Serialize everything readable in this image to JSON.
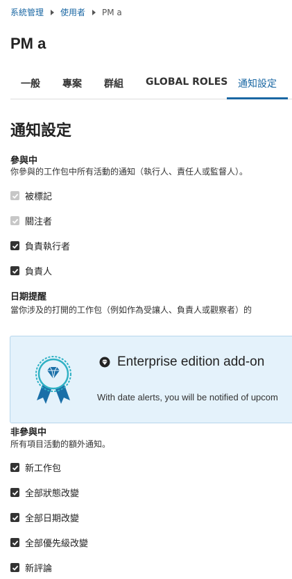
{
  "breadcrumb": {
    "items": [
      "系統管理",
      "使用者"
    ],
    "current": "PM a"
  },
  "page_title": "PM a",
  "tabs": [
    {
      "label": "一般"
    },
    {
      "label": "專案"
    },
    {
      "label": "群組"
    },
    {
      "label": "GLOBAL ROLES"
    },
    {
      "label": "通知設定",
      "active": true
    }
  ],
  "section_title": "通知設定",
  "participating": {
    "title": "參與中",
    "description": "你參與的工作包中所有活動的通知（執行人、責任人或監督人）。",
    "options": [
      {
        "label": "被標記",
        "checked": true,
        "disabled": true
      },
      {
        "label": "關注者",
        "checked": true,
        "disabled": true
      },
      {
        "label": "負責執行者",
        "checked": true,
        "disabled": false
      },
      {
        "label": "負責人",
        "checked": true,
        "disabled": false
      }
    ]
  },
  "date_alerts": {
    "title": "日期提醒",
    "description": "當你涉及的打開的工作包（例如作為受讓人、負責人或觀察者）的",
    "enterprise": {
      "title": "Enterprise edition add-on",
      "text": "With date alerts, you will be notified of upcom"
    }
  },
  "non_participating": {
    "title": "非參與中",
    "description": "所有項目活動的額外通知。",
    "options": [
      {
        "label": "新工作包",
        "checked": true
      },
      {
        "label": "全部狀態改變",
        "checked": true
      },
      {
        "label": "全部日期改變",
        "checked": true
      },
      {
        "label": "全部優先級改變",
        "checked": true
      },
      {
        "label": "新評論",
        "checked": true
      }
    ]
  },
  "colors": {
    "accent": "#1a67a3",
    "enterprise_bg": "#e4f2fb",
    "badge": "#1a6fa8"
  },
  "icons": {
    "breadcrumb_separator": "caret-right-icon",
    "enterprise": "diamond-icon",
    "badge": "ribbon-badge-icon",
    "check": "checkmark-icon"
  }
}
